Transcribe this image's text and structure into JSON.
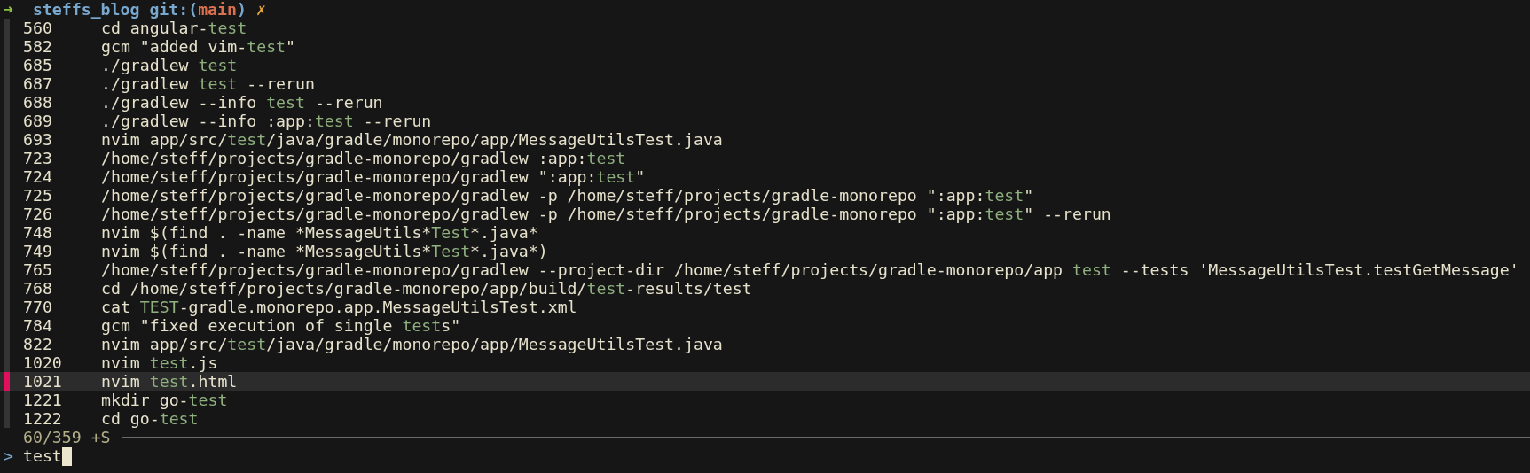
{
  "prompt": {
    "arrow": "➜",
    "directory": "steffs_blog",
    "git_label": "git:(",
    "branch": "main",
    "git_close": ")",
    "dirty_mark": "✗"
  },
  "history": [
    {
      "number": "560",
      "selected": false,
      "segments": [
        {
          "text": "cd angular-",
          "match": false
        },
        {
          "text": "test",
          "match": true
        }
      ]
    },
    {
      "number": "582",
      "selected": false,
      "segments": [
        {
          "text": "gcm \"added vim-",
          "match": false
        },
        {
          "text": "test",
          "match": true
        },
        {
          "text": "\"",
          "match": false
        }
      ]
    },
    {
      "number": "685",
      "selected": false,
      "segments": [
        {
          "text": "./gradlew ",
          "match": false
        },
        {
          "text": "test",
          "match": true
        }
      ]
    },
    {
      "number": "687",
      "selected": false,
      "segments": [
        {
          "text": "./gradlew ",
          "match": false
        },
        {
          "text": "test",
          "match": true
        },
        {
          "text": " --rerun",
          "match": false
        }
      ]
    },
    {
      "number": "688",
      "selected": false,
      "segments": [
        {
          "text": "./gradlew --info ",
          "match": false
        },
        {
          "text": "test",
          "match": true
        },
        {
          "text": " --rerun",
          "match": false
        }
      ]
    },
    {
      "number": "689",
      "selected": false,
      "segments": [
        {
          "text": "./gradlew --info :app:",
          "match": false
        },
        {
          "text": "test",
          "match": true
        },
        {
          "text": " --rerun",
          "match": false
        }
      ]
    },
    {
      "number": "693",
      "selected": false,
      "segments": [
        {
          "text": "nvim app/src/",
          "match": false
        },
        {
          "text": "test",
          "match": true
        },
        {
          "text": "/java/gradle/monorepo/app/MessageUtilsTest.java",
          "match": false
        }
      ]
    },
    {
      "number": "723",
      "selected": false,
      "segments": [
        {
          "text": "/home/steff/projects/gradle-monorepo/gradlew :app:",
          "match": false
        },
        {
          "text": "test",
          "match": true
        }
      ]
    },
    {
      "number": "724",
      "selected": false,
      "segments": [
        {
          "text": "/home/steff/projects/gradle-monorepo/gradlew \":app:",
          "match": false
        },
        {
          "text": "test",
          "match": true
        },
        {
          "text": "\"",
          "match": false
        }
      ]
    },
    {
      "number": "725",
      "selected": false,
      "segments": [
        {
          "text": "/home/steff/projects/gradle-monorepo/gradlew -p /home/steff/projects/gradle-monorepo \":app:",
          "match": false
        },
        {
          "text": "test",
          "match": true
        },
        {
          "text": "\"",
          "match": false
        }
      ]
    },
    {
      "number": "726",
      "selected": false,
      "segments": [
        {
          "text": "/home/steff/projects/gradle-monorepo/gradlew -p /home/steff/projects/gradle-monorepo \":app:",
          "match": false
        },
        {
          "text": "test",
          "match": true
        },
        {
          "text": "\" --rerun",
          "match": false
        }
      ]
    },
    {
      "number": "748",
      "selected": false,
      "segments": [
        {
          "text": "nvim $(find . -name *MessageUtils*",
          "match": false
        },
        {
          "text": "Test",
          "match": true
        },
        {
          "text": "*.java*",
          "match": false
        }
      ]
    },
    {
      "number": "749",
      "selected": false,
      "segments": [
        {
          "text": "nvim $(find . -name *MessageUtils*",
          "match": false
        },
        {
          "text": "Test",
          "match": true
        },
        {
          "text": "*.java*)",
          "match": false
        }
      ]
    },
    {
      "number": "765",
      "selected": false,
      "segments": [
        {
          "text": "/home/steff/projects/gradle-monorepo/gradlew --project-dir /home/steff/projects/gradle-monorepo/app ",
          "match": false
        },
        {
          "text": "test",
          "match": true
        },
        {
          "text": " --tests 'MessageUtilsTest.testGetMessage'",
          "match": false
        }
      ]
    },
    {
      "number": "768",
      "selected": false,
      "segments": [
        {
          "text": "cd /home/steff/projects/gradle-monorepo/app/build/",
          "match": false
        },
        {
          "text": "test",
          "match": true
        },
        {
          "text": "-results/test",
          "match": false
        }
      ]
    },
    {
      "number": "770",
      "selected": false,
      "segments": [
        {
          "text": "cat ",
          "match": false
        },
        {
          "text": "TEST",
          "match": true
        },
        {
          "text": "-gradle.monorepo.app.MessageUtilsTest.xml",
          "match": false
        }
      ]
    },
    {
      "number": "784",
      "selected": false,
      "segments": [
        {
          "text": "gcm \"fixed execution of single ",
          "match": false
        },
        {
          "text": "test",
          "match": true
        },
        {
          "text": "s\"",
          "match": false
        }
      ]
    },
    {
      "number": "822",
      "selected": false,
      "segments": [
        {
          "text": "nvim app/src/",
          "match": false
        },
        {
          "text": "test",
          "match": true
        },
        {
          "text": "/java/gradle/monorepo/app/MessageUtilsTest.java",
          "match": false
        }
      ]
    },
    {
      "number": "1020",
      "selected": false,
      "segments": [
        {
          "text": "nvim ",
          "match": false
        },
        {
          "text": "test",
          "match": true
        },
        {
          "text": ".js",
          "match": false
        }
      ]
    },
    {
      "number": "1021",
      "selected": true,
      "segments": [
        {
          "text": "nvim ",
          "match": false
        },
        {
          "text": "test",
          "match": true
        },
        {
          "text": ".html",
          "match": false
        }
      ]
    },
    {
      "number": "1221",
      "selected": false,
      "segments": [
        {
          "text": "mkdir go-",
          "match": false
        },
        {
          "text": "test",
          "match": true
        }
      ]
    },
    {
      "number": "1222",
      "selected": false,
      "segments": [
        {
          "text": "cd go-",
          "match": false
        },
        {
          "text": "test",
          "match": true
        }
      ]
    }
  ],
  "info": {
    "count": "60/359 +S"
  },
  "query": {
    "prompt": ">",
    "value": "test"
  }
}
